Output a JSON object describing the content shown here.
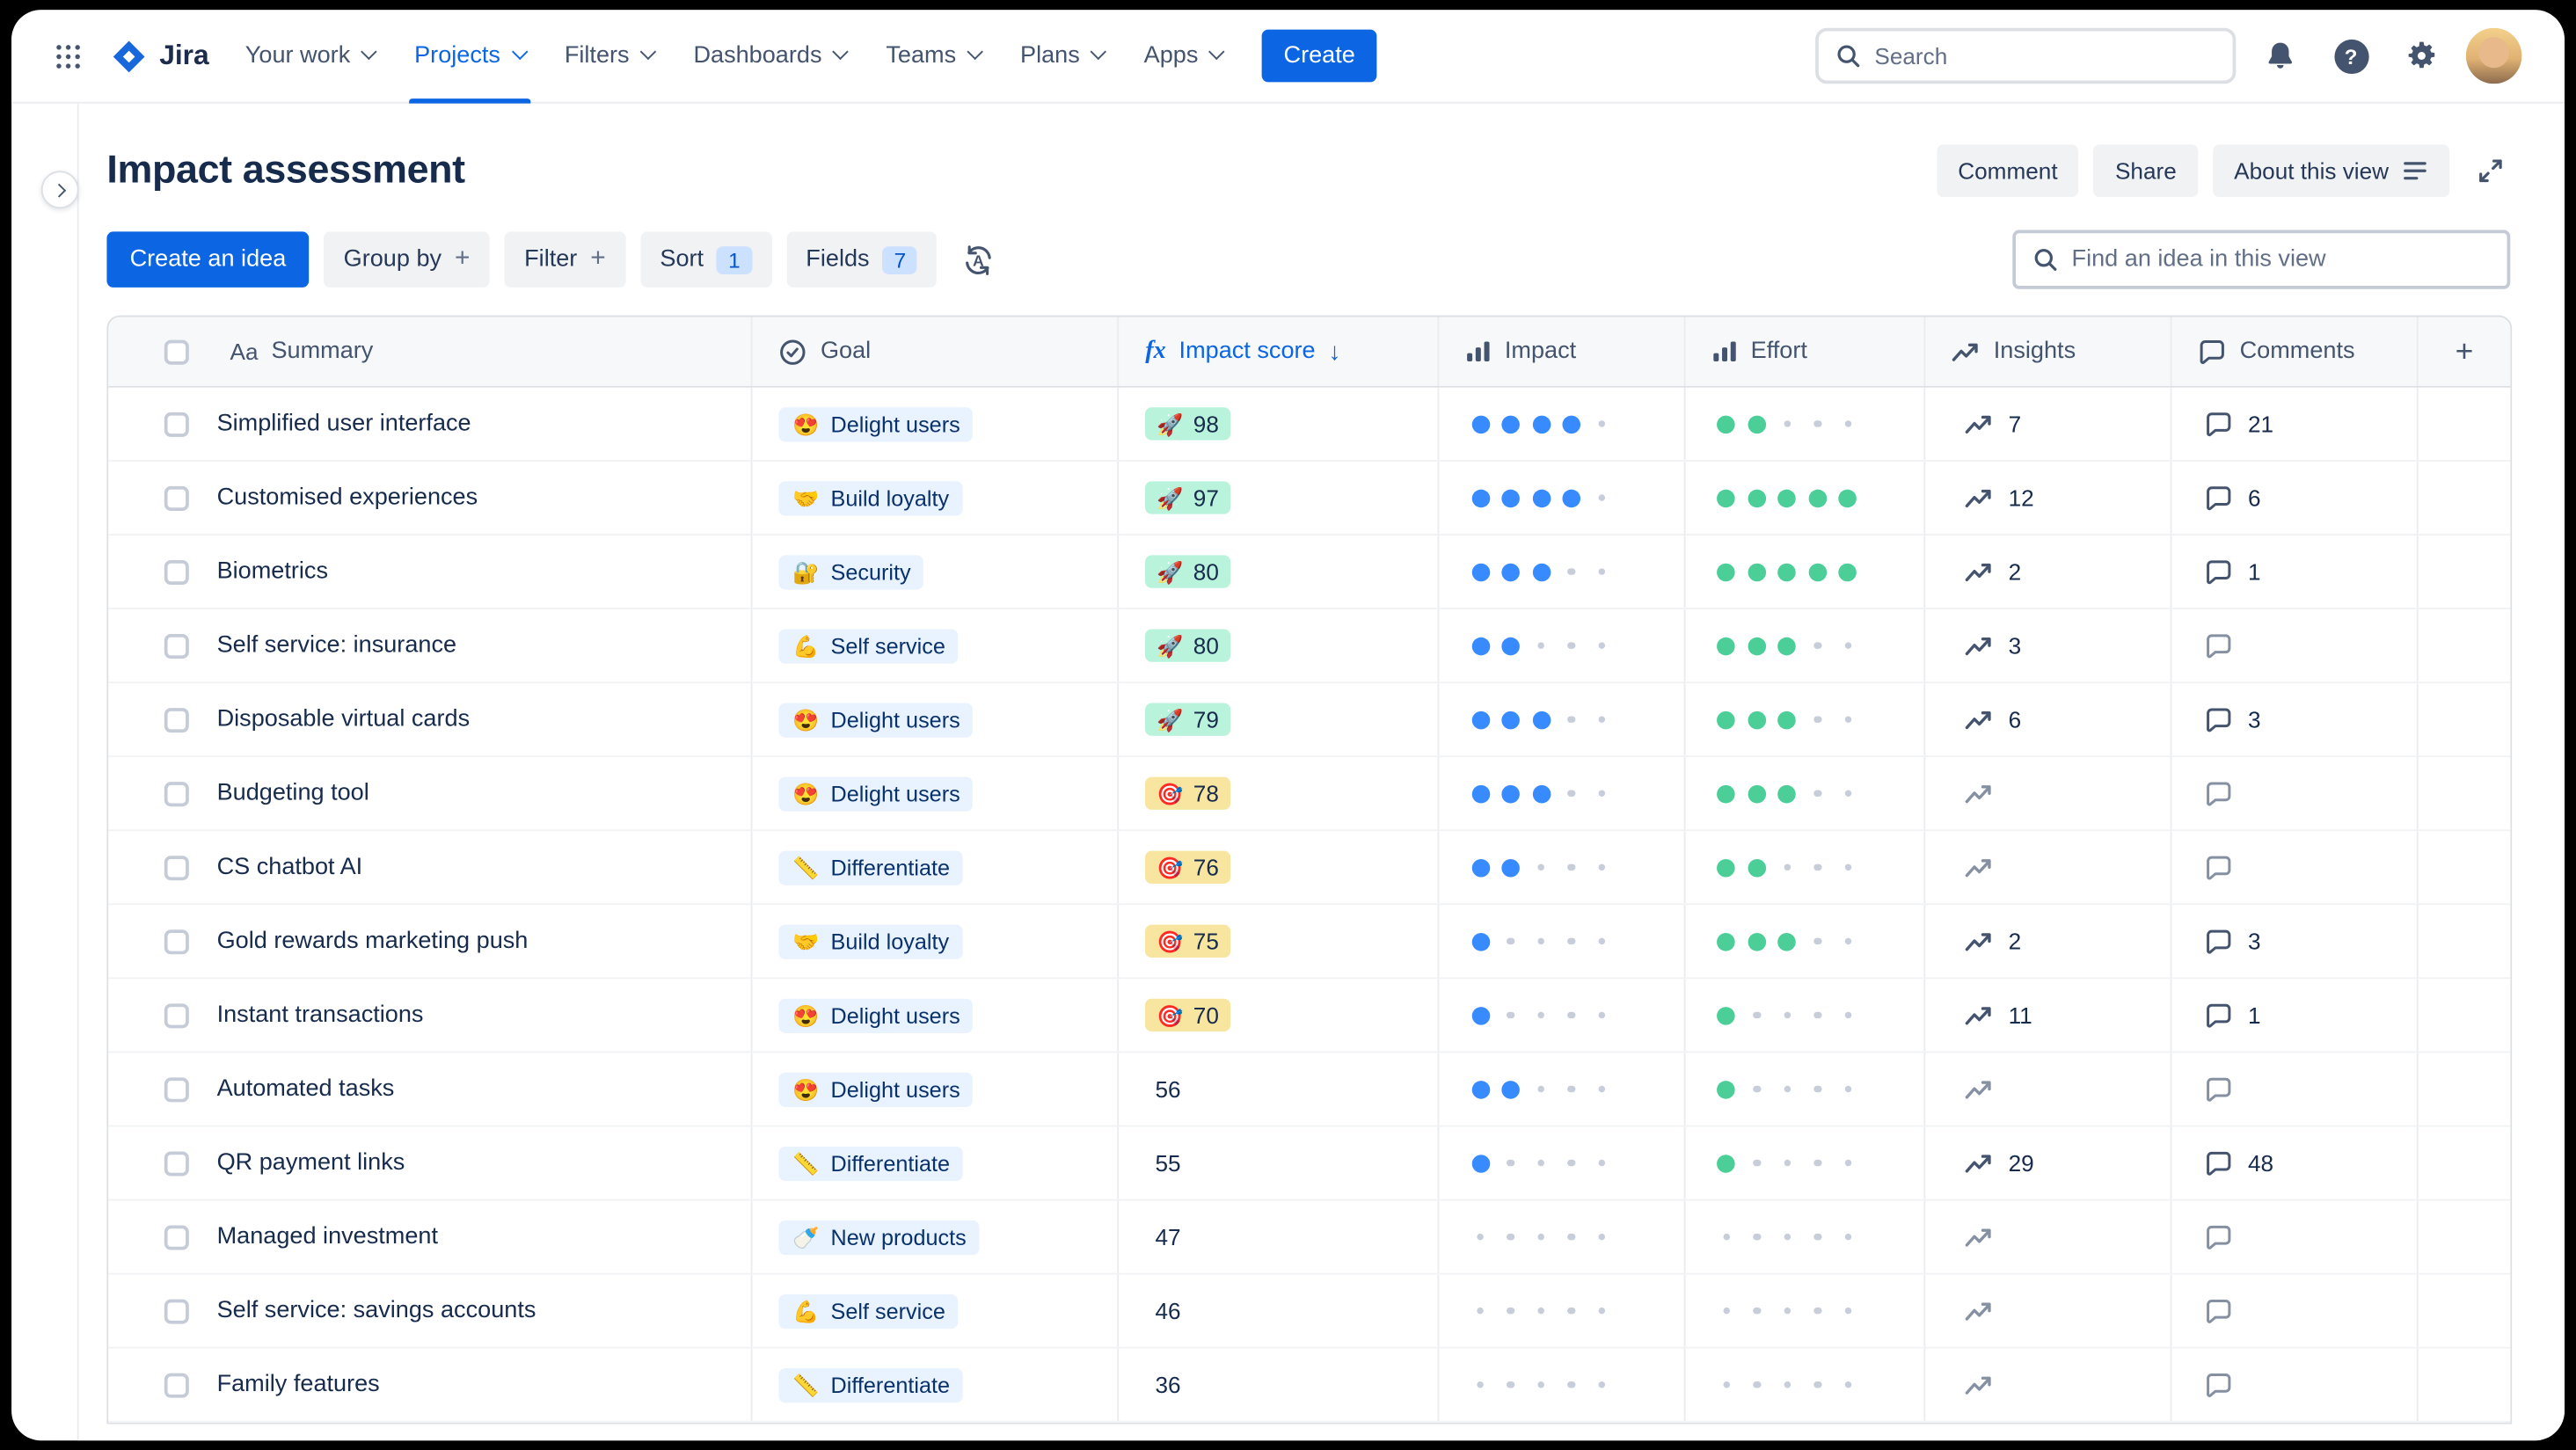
{
  "nav": {
    "logo": "Jira",
    "items": [
      {
        "label": "Your work"
      },
      {
        "label": "Projects",
        "active": true
      },
      {
        "label": "Filters"
      },
      {
        "label": "Dashboards"
      },
      {
        "label": "Teams"
      },
      {
        "label": "Plans"
      },
      {
        "label": "Apps"
      }
    ],
    "create_label": "Create",
    "search_placeholder": "Search"
  },
  "header": {
    "title": "Impact assessment",
    "comment_label": "Comment",
    "share_label": "Share",
    "about_label": "About this view"
  },
  "toolbar": {
    "create_idea_label": "Create an idea",
    "group_by_label": "Group by",
    "filter_label": "Filter",
    "sort_label": "Sort",
    "sort_count": "1",
    "fields_label": "Fields",
    "fields_count": "7",
    "find_placeholder": "Find an idea in this view"
  },
  "table": {
    "header": {
      "summary_glyph": "Aa",
      "summary": "Summary",
      "goal": "Goal",
      "formula_glyph": "fx",
      "impact_score": "Impact score",
      "sort_arrow": "↓",
      "impact": "Impact",
      "effort": "Effort",
      "insights": "Insights",
      "comments": "Comments"
    },
    "colors": {
      "impact_dot": "#388BFF",
      "effort_dot": "#4BCE97",
      "score_green_bg": "#BAF3DB",
      "score_yellow_bg": "#F8E6A0",
      "goal_chip_bg": "#E9F2FF",
      "accent_blue": "#0C66E4"
    },
    "rows": [
      {
        "summary": "Simplified user interface",
        "goal_emoji": "😍",
        "goal": "Delight users",
        "score": 98,
        "score_style": "green",
        "score_emoji": "🚀",
        "impact": 4,
        "effort": 2,
        "insights": 7,
        "comments": 21
      },
      {
        "summary": "Customised experiences",
        "goal_emoji": "🤝",
        "goal": "Build loyalty",
        "score": 97,
        "score_style": "green",
        "score_emoji": "🚀",
        "impact": 4,
        "effort": 5,
        "insights": 12,
        "comments": 6
      },
      {
        "summary": "Biometrics",
        "goal_emoji": "🔐",
        "goal": "Security",
        "score": 80,
        "score_style": "green",
        "score_emoji": "🚀",
        "impact": 3,
        "effort": 5,
        "insights": 2,
        "comments": 1
      },
      {
        "summary": "Self service: insurance",
        "goal_emoji": "💪",
        "goal": "Self service",
        "score": 80,
        "score_style": "green",
        "score_emoji": "🚀",
        "impact": 2,
        "effort": 3,
        "insights": 3,
        "comments": null
      },
      {
        "summary": "Disposable virtual cards",
        "goal_emoji": "😍",
        "goal": "Delight users",
        "score": 79,
        "score_style": "green",
        "score_emoji": "🚀",
        "impact": 3,
        "effort": 3,
        "insights": 6,
        "comments": 3
      },
      {
        "summary": "Budgeting tool",
        "goal_emoji": "😍",
        "goal": "Delight users",
        "score": 78,
        "score_style": "yellow",
        "score_emoji": "🎯",
        "impact": 3,
        "effort": 3,
        "insights": null,
        "comments": null
      },
      {
        "summary": "CS chatbot AI",
        "goal_emoji": "📏",
        "goal": "Differentiate",
        "score": 76,
        "score_style": "yellow",
        "score_emoji": "🎯",
        "impact": 2,
        "effort": 2,
        "insights": null,
        "comments": null
      },
      {
        "summary": "Gold rewards marketing push",
        "goal_emoji": "🤝",
        "goal": "Build loyalty",
        "score": 75,
        "score_style": "yellow",
        "score_emoji": "🎯",
        "impact": 1,
        "effort": 3,
        "insights": 2,
        "comments": 3
      },
      {
        "summary": "Instant transactions",
        "goal_emoji": "😍",
        "goal": "Delight users",
        "score": 70,
        "score_style": "yellow",
        "score_emoji": "🎯",
        "impact": 1,
        "effort": 1,
        "insights": 11,
        "comments": 1
      },
      {
        "summary": "Automated tasks",
        "goal_emoji": "😍",
        "goal": "Delight users",
        "score": 56,
        "score_style": "plain",
        "score_emoji": null,
        "impact": 2,
        "effort": 1,
        "insights": null,
        "comments": null
      },
      {
        "summary": "QR payment links",
        "goal_emoji": "📏",
        "goal": "Differentiate",
        "score": 55,
        "score_style": "plain",
        "score_emoji": null,
        "impact": 1,
        "effort": 1,
        "insights": 29,
        "comments": 48
      },
      {
        "summary": "Managed investment",
        "goal_emoji": "🍼",
        "goal": "New products",
        "score": 47,
        "score_style": "plain",
        "score_emoji": null,
        "impact": 0,
        "effort": 0,
        "insights": null,
        "comments": null
      },
      {
        "summary": "Self service: savings accounts",
        "goal_emoji": "💪",
        "goal": "Self service",
        "score": 46,
        "score_style": "plain",
        "score_emoji": null,
        "impact": 0,
        "effort": 0,
        "insights": null,
        "comments": null
      },
      {
        "summary": "Family features",
        "goal_emoji": "📏",
        "goal": "Differentiate",
        "score": 36,
        "score_style": "plain",
        "score_emoji": null,
        "impact": 0,
        "effort": 0,
        "insights": null,
        "comments": null
      }
    ]
  }
}
